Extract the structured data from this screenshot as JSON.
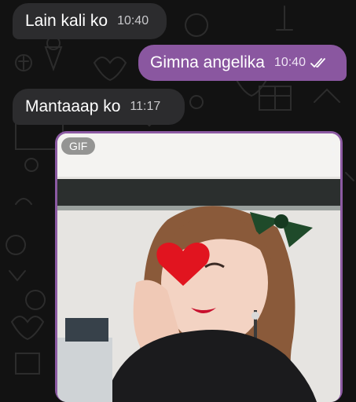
{
  "messages": [
    {
      "direction": "incoming",
      "text": "Lain kali ko",
      "time": "10:40"
    },
    {
      "direction": "outgoing",
      "text": "Gimna angelika",
      "time": "10:40",
      "status": "read"
    },
    {
      "direction": "incoming",
      "text": "Mantaaap ko",
      "time": "11:17"
    }
  ],
  "gif": {
    "badge": "GIF",
    "menu_icon": "more-vertical-icon"
  },
  "colors": {
    "background": "#121212",
    "incoming_bubble": "#2c2c2e",
    "outgoing_bubble": "#8a57a0",
    "read_ticks": "#ffffff"
  }
}
